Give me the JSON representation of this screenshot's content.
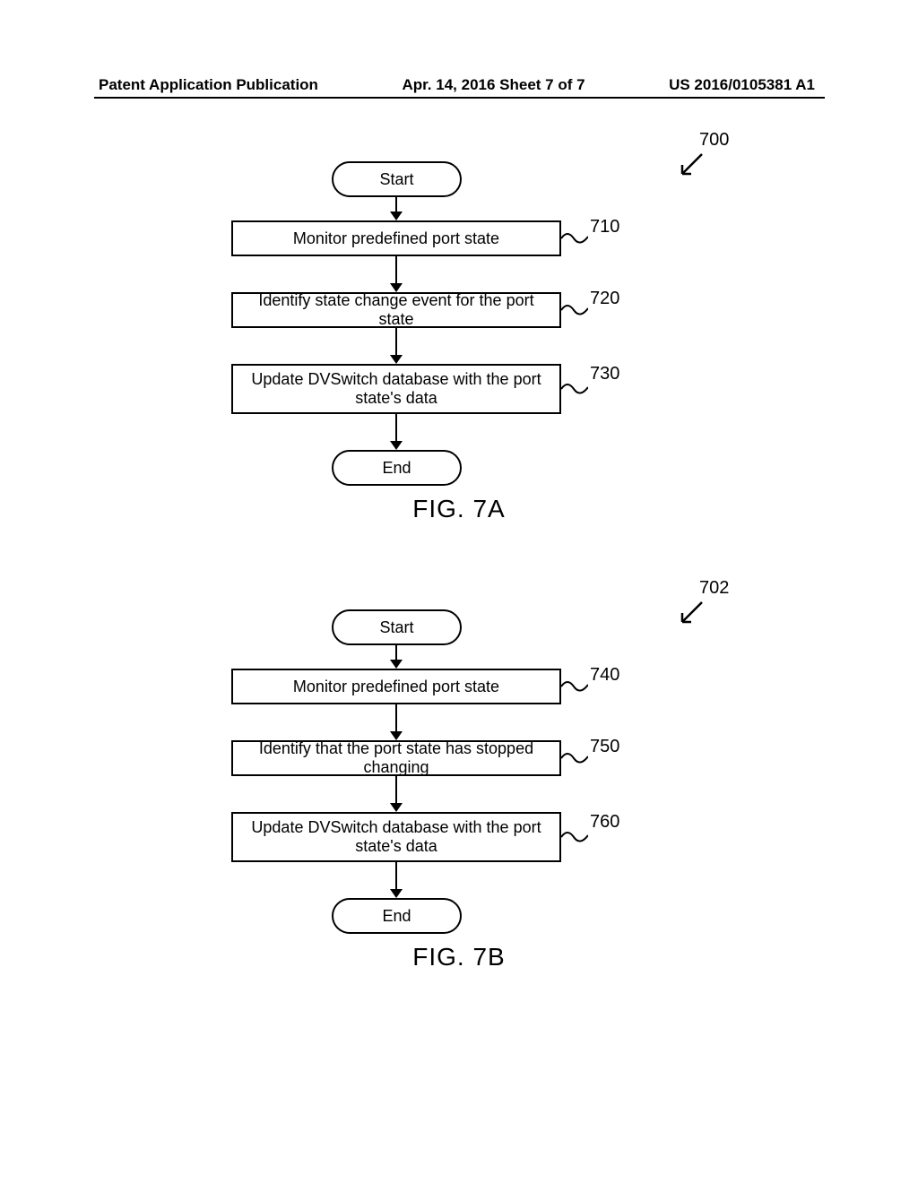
{
  "header": {
    "left": "Patent Application Publication",
    "center": "Apr. 14, 2016  Sheet 7 of 7",
    "right": "US 2016/0105381 A1"
  },
  "figA": {
    "start": "Start",
    "step1": "Monitor predefined port state",
    "step2": "Identify state change event for the port state",
    "step3": "Update DVSwitch database with the port state's data",
    "end": "End",
    "caption": "FIG. 7A",
    "ref_main": "700",
    "ref1": "710",
    "ref2": "720",
    "ref3": "730"
  },
  "figB": {
    "start": "Start",
    "step1": "Monitor predefined port state",
    "step2": "Identify that the port state has stopped changing",
    "step3": "Update DVSwitch database with the port state's data",
    "end": "End",
    "caption": "FIG. 7B",
    "ref_main": "702",
    "ref1": "740",
    "ref2": "750",
    "ref3": "760"
  }
}
